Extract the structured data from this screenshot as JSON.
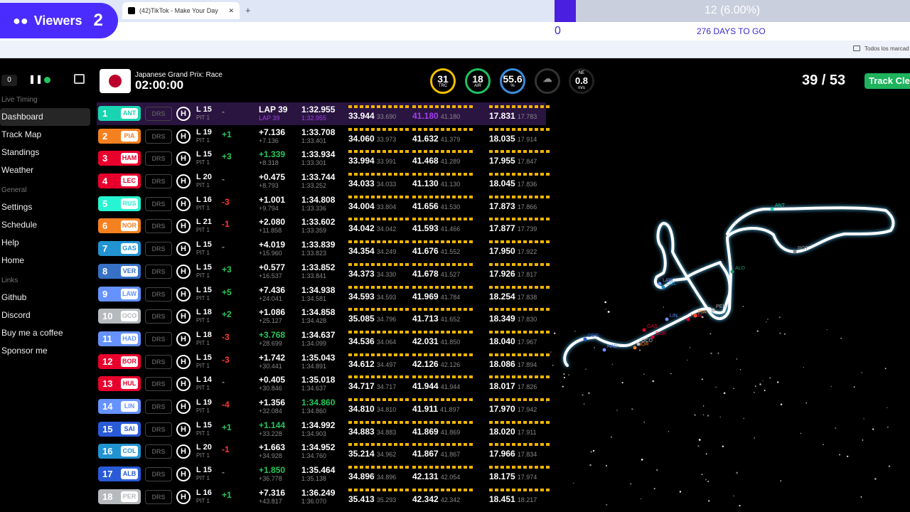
{
  "browser": {
    "tab_title": "(42)TikTok - Make Your Day",
    "url_frag": "shboard",
    "bookmarks_label": "Todos los marcad",
    "new_tab": "+",
    "close_tab": "✕"
  },
  "overlay": {
    "viewers_label": "Viewers",
    "viewers_count": "2",
    "progress_text": "12 (6.00%)",
    "progress_fraction": 0.06,
    "count": "0",
    "days": "276 DAYS TO GO"
  },
  "sidebar": {
    "status": "0",
    "live_timing": "Live Timing",
    "items_live": [
      "Dashboard",
      "Track Map",
      "Standings",
      "Weather"
    ],
    "general": "General",
    "items_general": [
      "Settings",
      "Schedule",
      "Help",
      "Home"
    ],
    "links": "Links",
    "items_links": [
      "Github",
      "Discord",
      "Buy me a coffee",
      "Sponsor me"
    ]
  },
  "session": {
    "title": "Japanese Grand Prix: Race",
    "clock": "02:00:00",
    "laps": "39 / 53",
    "track_status": "Track Clear",
    "gauges": [
      {
        "value": "31",
        "label": "TRC",
        "color": "#f0c000"
      },
      {
        "value": "18",
        "label": "AIR",
        "color": "#20c060"
      },
      {
        "value": "55.6",
        "label": "%",
        "color": "#3a8de0"
      }
    ],
    "wind": {
      "dir": "NE",
      "speed": "0.8",
      "unit": "m/s"
    }
  },
  "colors": {
    "purple": "#a33ef0",
    "green": "#27c75a",
    "red": "#ff3838",
    "track_clear": "#1eb35c"
  },
  "drivers": [
    {
      "pos": "1",
      "code": "ANT",
      "color": "#19d4b0",
      "drs": "DRS",
      "tyre": "H",
      "lap": "L 15",
      "pit": "PIT 1",
      "chg": "-",
      "chgc": "",
      "gap": "LAP 39",
      "gap2": "LAP 39",
      "best": "1:32.955",
      "best2": "1:32.955",
      "s1": "33.944",
      "s1b": "33.690",
      "s2": "41.180",
      "s2b": "41.180",
      "s3": "17.831",
      "s3b": "17.783",
      "hl": true
    },
    {
      "pos": "2",
      "code": "PIA",
      "color": "#f58020",
      "drs": "DRS",
      "tyre": "H",
      "lap": "L 19",
      "pit": "PIT 1",
      "chg": "+1",
      "chgc": "green",
      "gap": "+7.136",
      "gap2": "+7.136",
      "best": "1:33.708",
      "best2": "1:33.401",
      "s1": "34.060",
      "s1b": "33.973",
      "s2": "41.632",
      "s2b": "41.379",
      "s3": "18.035",
      "s3b": "17.914"
    },
    {
      "pos": "3",
      "code": "HAM",
      "color": "#e8002d",
      "drs": "DRS",
      "tyre": "H",
      "lap": "L 15",
      "pit": "PIT 1",
      "chg": "+3",
      "chgc": "green",
      "gap": "+1.339",
      "gap2": "+8.318",
      "best": "1:33.934",
      "best2": "1:33.301",
      "s1": "33.994",
      "s1b": "33.991",
      "s2": "41.468",
      "s2b": "41.289",
      "s3": "17.955",
      "s3b": "17.847",
      "gapc": "green"
    },
    {
      "pos": "4",
      "code": "LEC",
      "color": "#e8002d",
      "drs": "DRS",
      "tyre": "H",
      "lap": "L 20",
      "pit": "PIT 1",
      "chg": "-",
      "chgc": "",
      "gap": "+0.475",
      "gap2": "+8.793",
      "best": "1:33.744",
      "best2": "1:33.252",
      "s1": "34.033",
      "s1b": "34.033",
      "s2": "41.130",
      "s2b": "41.130",
      "s3": "18.045",
      "s3b": "17.836",
      "s1c": "green",
      "s2c": "purple"
    },
    {
      "pos": "5",
      "code": "RUS",
      "color": "#27f4d2",
      "drs": "DRS",
      "tyre": "H",
      "lap": "L 16",
      "pit": "PIT 1",
      "chg": "-3",
      "chgc": "red",
      "gap": "+1.001",
      "gap2": "+9.794",
      "best": "1:34.808",
      "best2": "1:33.336",
      "s1": "34.004",
      "s1b": "33.804",
      "s2": "41.656",
      "s2b": "41.530",
      "s3": "17.873",
      "s3b": "17.866"
    },
    {
      "pos": "6",
      "code": "NOR",
      "color": "#f58020",
      "drs": "DRS",
      "tyre": "H",
      "lap": "L 21",
      "pit": "PIT 1",
      "chg": "-1",
      "chgc": "red",
      "gap": "+2.080",
      "gap2": "+11.858",
      "best": "1:33.602",
      "best2": "1:33.359",
      "s1": "34.042",
      "s1b": "34.042",
      "s2": "41.593",
      "s2b": "41.466",
      "s3": "17.877",
      "s3b": "17.739",
      "s1c": "green",
      "s3bc": "purple"
    },
    {
      "pos": "7",
      "code": "GAS",
      "color": "#2293d1",
      "drs": "DRS",
      "tyre": "H",
      "lap": "L 15",
      "pit": "PIT 1",
      "chg": "-",
      "chgc": "",
      "gap": "+4.019",
      "gap2": "+15.960",
      "best": "1:33.839",
      "best2": "1:33.823",
      "s1": "34.354",
      "s1b": "34.249",
      "s2": "41.676",
      "s2b": "41.552",
      "s3": "17.950",
      "s3b": "17.922"
    },
    {
      "pos": "8",
      "code": "VER",
      "color": "#3671c6",
      "drs": "DRS",
      "tyre": "H",
      "lap": "L 15",
      "pit": "PIT 1",
      "chg": "+3",
      "chgc": "green",
      "gap": "+0.577",
      "gap2": "+16.537",
      "best": "1:33.852",
      "best2": "1:33.841",
      "s1": "34.373",
      "s1b": "34.330",
      "s2": "41.678",
      "s2b": "41.527",
      "s3": "17.926",
      "s3b": "17.817"
    },
    {
      "pos": "9",
      "code": "LAW",
      "color": "#6692ff",
      "drs": "DRS",
      "tyre": "H",
      "lap": "L 15",
      "pit": "PIT 1",
      "chg": "+5",
      "chgc": "green",
      "gap": "+7.436",
      "gap2": "+24.041",
      "best": "1:34.938",
      "best2": "1:34.581",
      "s1": "34.593",
      "s1b": "34.593",
      "s2": "41.969",
      "s2b": "41.784",
      "s3": "18.254",
      "s3b": "17.838",
      "s1c": "green"
    },
    {
      "pos": "10",
      "code": "OCO",
      "color": "#b6babd",
      "drs": "DRS",
      "tyre": "H",
      "lap": "L 18",
      "pit": "PIT 1",
      "chg": "+2",
      "chgc": "green",
      "gap": "+1.086",
      "gap2": "+25.127",
      "best": "1:34.858",
      "best2": "1:34.428",
      "s1": "35.085",
      "s1b": "34.796",
      "s2": "41.713",
      "s2b": "41.652",
      "s3": "18.349",
      "s3b": "17.830"
    },
    {
      "pos": "11",
      "code": "HAD",
      "color": "#6692ff",
      "drs": "DRS",
      "tyre": "H",
      "lap": "L 18",
      "pit": "PIT 1",
      "chg": "-3",
      "chgc": "red",
      "gap": "+3.768",
      "gap2": "+28.699",
      "best": "1:34.637",
      "best2": "1:34.099",
      "s1": "34.536",
      "s1b": "34.064",
      "s2": "42.031",
      "s2b": "41.850",
      "s3": "18.040",
      "s3b": "17.967",
      "gapc": "green"
    },
    {
      "pos": "12",
      "code": "BOR",
      "color": "#e8002d",
      "drs": "DRS",
      "tyre": "H",
      "lap": "L 15",
      "pit": "PIT 1",
      "chg": "-3",
      "chgc": "red",
      "gap": "+1.742",
      "gap2": "+30.441",
      "best": "1:35.043",
      "best2": "1:34.891",
      "s1": "34.612",
      "s1b": "34.497",
      "s2": "42.126",
      "s2b": "42.126",
      "s3": "18.086",
      "s3b": "17.894"
    },
    {
      "pos": "13",
      "code": "HUL",
      "color": "#e8002d",
      "drs": "DRS",
      "tyre": "H",
      "lap": "L 14",
      "pit": "PIT 1",
      "chg": "-",
      "chgc": "",
      "gap": "+0.405",
      "gap2": "+30.846",
      "best": "1:35.018",
      "best2": "1:34.637",
      "s1": "34.717",
      "s1b": "34.717",
      "s2": "41.944",
      "s2b": "41.944",
      "s3": "18.017",
      "s3b": "17.826",
      "s1c": "green"
    },
    {
      "pos": "14",
      "code": "LIN",
      "color": "#6692ff",
      "drs": "DRS",
      "tyre": "H",
      "lap": "L 19",
      "pit": "PIT 1",
      "chg": "-4",
      "chgc": "red",
      "gap": "+1.356",
      "gap2": "+32.084",
      "best": "1:34.860",
      "best2": "1:34.860",
      "s1": "34.810",
      "s1b": "34.810",
      "s2": "41.911",
      "s2b": "41.897",
      "s3": "17.970",
      "s3b": "17.942",
      "s1c": "green",
      "bestc": "green"
    },
    {
      "pos": "15",
      "code": "SAI",
      "color": "#2a5bd7",
      "drs": "DRS",
      "tyre": "H",
      "lap": "L 15",
      "pit": "PIT 1",
      "chg": "+1",
      "chgc": "green",
      "gap": "+1.144",
      "gap2": "+33.228",
      "best": "1:34.992",
      "best2": "1:34.903",
      "s1": "34.883",
      "s1b": "34.883",
      "s2": "41.869",
      "s2b": "41.869",
      "s3": "18.020",
      "s3b": "17.911",
      "s1c": "green",
      "gapc": "green"
    },
    {
      "pos": "16",
      "code": "COL",
      "color": "#2293d1",
      "drs": "DRS",
      "tyre": "H",
      "lap": "L 20",
      "pit": "PIT 1",
      "chg": "-1",
      "chgc": "red",
      "gap": "+1.663",
      "gap2": "+34.928",
      "best": "1:34.952",
      "best2": "1:34.760",
      "s1": "35.214",
      "s1b": "34.962",
      "s2": "41.867",
      "s2b": "41.867",
      "s3": "17.966",
      "s3b": "17.834"
    },
    {
      "pos": "17",
      "code": "ALB",
      "color": "#2a5bd7",
      "drs": "DRS",
      "tyre": "H",
      "lap": "L 15",
      "pit": "PIT 1",
      "chg": "-",
      "chgc": "",
      "gap": "+1.850",
      "gap2": "+36.778",
      "best": "1:35.464",
      "best2": "1:35.138",
      "s1": "34.896",
      "s1b": "34.896",
      "s2": "42.131",
      "s2b": "42.054",
      "s3": "18.175",
      "s3b": "17.974",
      "s1c": "green",
      "gapc": "green"
    },
    {
      "pos": "18",
      "code": "PER",
      "color": "#b6babd",
      "drs": "DRS",
      "tyre": "H",
      "lap": "L 16",
      "pit": "PIT 1",
      "chg": "+1",
      "chgc": "green",
      "gap": "+7.316",
      "gap2": "+43.817",
      "best": "1:36.249",
      "best2": "1:36.070",
      "s1": "35.413",
      "s1b": "35.293",
      "s2": "42.342",
      "s2b": "42.342",
      "s3": "18.451",
      "s3b": "18.217"
    }
  ],
  "map_labels": [
    "ANT",
    "ROT",
    "ALO",
    "PER",
    "PIA",
    "HAM",
    "LIN",
    "GAS",
    "COL",
    "LAW",
    "BOR",
    "DDD",
    "HAD",
    "NOR",
    "OCO"
  ]
}
